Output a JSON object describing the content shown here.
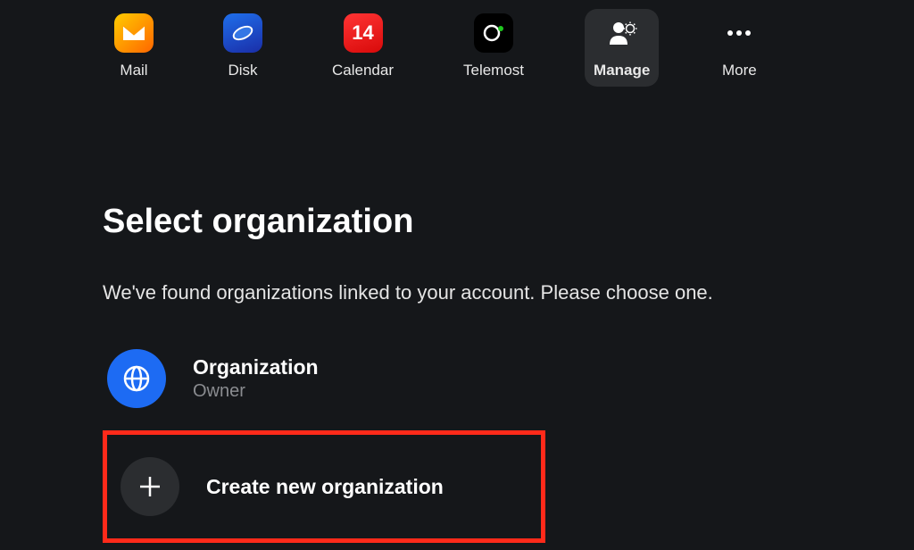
{
  "nav": {
    "mail": "Mail",
    "disk": "Disk",
    "calendar": "Calendar",
    "calendar_date": "14",
    "telemost": "Telemost",
    "manage": "Manage",
    "more": "More"
  },
  "page": {
    "title": "Select organization",
    "subtitle": "We've found organizations linked to your account. Please choose one."
  },
  "organizations": [
    {
      "name": "Organization",
      "role": "Owner"
    }
  ],
  "create": {
    "label": "Create new organization"
  }
}
